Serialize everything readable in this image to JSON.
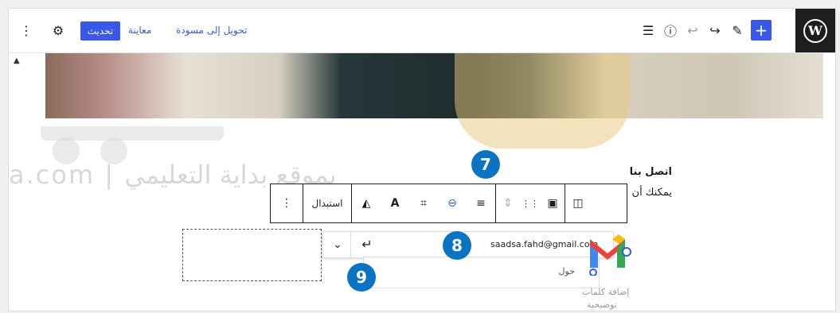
{
  "topbar": {
    "wp_logo": "W",
    "plus_label": "+",
    "pen_icon": "✎",
    "redo_icon": "↪",
    "undo_icon": "↩",
    "info_icon": "ⓘ",
    "list_icon": "☰",
    "convert_draft_label": "تحويل إلى مسودة",
    "preview_label": "معاينة",
    "update_label": "تحديث",
    "settings_icon": "⚙",
    "more_icon": "⋮"
  },
  "content": {
    "heading": "اتصل بنا",
    "subtext": "يمكنك أن"
  },
  "watermark": {
    "text": "a.com | بموقع بداية التعليمي"
  },
  "block_toolbar": {
    "replace_label": "استبدال",
    "more_icon": "⋮",
    "duotone_icon": "◭",
    "text_over_image_icon": "A",
    "crop_icon": "⌗",
    "link_icon": "⊖",
    "align_icon": "≡",
    "move_icon": "⇕",
    "drag_icon": "⋮⋮",
    "image_type_icon": "▣",
    "block_switcher_icon": "◫"
  },
  "link_popover": {
    "email": "saadsa.fahd@gmail.com",
    "submit_icon": "↵",
    "chevron_icon": "⌄"
  },
  "caption": {
    "value": "حول",
    "alt_text_label_1": "إضافة كلمات",
    "alt_text_label_2": "توضيحية"
  },
  "badges": {
    "badge_7": "7",
    "badge_8": "8",
    "badge_9": "9"
  },
  "colors": {
    "accent": "#3858e9",
    "badge": "#0a74c2",
    "dark": "#1e1e1e"
  }
}
